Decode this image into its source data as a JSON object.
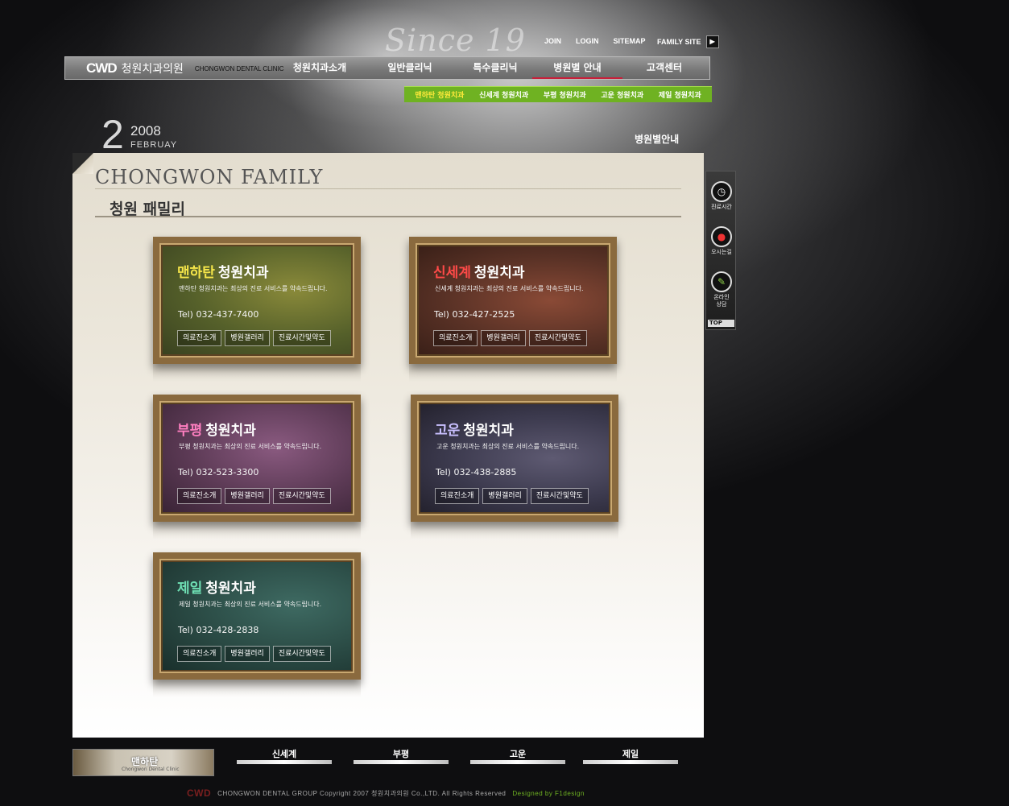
{
  "header": {
    "since_text": "Since 19",
    "top_links": [
      "JOIN",
      "LOGIN",
      "SITEMAP"
    ],
    "family_site": "FAMILY SITE"
  },
  "logo": {
    "mark": "CWD",
    "name_kr": "청원치과의원",
    "name_en": "CHONGWON DENTAL CLINIC"
  },
  "gnb": {
    "items": [
      "청원치과소개",
      "일반클리닉",
      "특수클리닉",
      "병원별 안내",
      "고객센터"
    ],
    "active": "병원별 안내"
  },
  "subnav": {
    "items": [
      "맨하탄 청원치과",
      "신세계 청원치과",
      "부평 청원치과",
      "고운 청원치과",
      "제일 청원치과"
    ],
    "active": "맨하탄 청원치과"
  },
  "date": {
    "day": "2",
    "year": "2008",
    "month": "FEBRUAY"
  },
  "breadcrumb": "병원별안내",
  "section": {
    "title_en": "CHONGWON  FAMILY",
    "title_kr": "청원 패밀리"
  },
  "clinics": [
    {
      "highlight": "맨하탄",
      "name": "청원치과",
      "desc": "맨하탄 청원치과는 최상의 진료 서비스를 약속드립니다.",
      "tel": "Tel) 032-437-7400",
      "buttons": [
        "의료진소개",
        "병원갤러리",
        "진료시간및약도"
      ],
      "highlight_color": "#f6e64a",
      "bg_color": "#5d6a2a"
    },
    {
      "highlight": "신세계",
      "name": "청원치과",
      "desc": "신세계 청원치과는 최상의 진료 서비스를 약속드립니다.",
      "tel": "Tel) 032-427-2525",
      "buttons": [
        "의료진소개",
        "병원갤러리",
        "진료시간및약도"
      ],
      "highlight_color": "#ff4a48",
      "bg_color": "#5a3226"
    },
    {
      "highlight": "부평",
      "name": "청원치과",
      "desc": "부평 청원치과는 최상의 진료 서비스를 약속드립니다.",
      "tel": "Tel) 032-523-3300",
      "buttons": [
        "의료진소개",
        "병원갤러리",
        "진료시간및약도"
      ],
      "highlight_color": "#ff7fc0",
      "bg_color": "#5c3a55"
    },
    {
      "highlight": "고운",
      "name": "청원치과",
      "desc": "고운 청원치과는 최상의 진료 서비스를 약속드립니다.",
      "tel": "Tel) 032-438-2885",
      "buttons": [
        "의료진소개",
        "병원갤러리",
        "진료시간및약도"
      ],
      "highlight_color": "#c9c0ff",
      "bg_color": "#3c3a4e"
    },
    {
      "highlight": "제일",
      "name": "청원치과",
      "desc": "제일 청원치과는 최상의 진료 서비스를 약속드립니다.",
      "tel": "Tel) 032-428-2838",
      "buttons": [
        "의료진소개",
        "병원갤러리",
        "진료시간및약도"
      ],
      "highlight_color": "#6fe0b4",
      "bg_color": "#2a4a44"
    }
  ],
  "quick_menu": {
    "items": [
      {
        "icon": "clock-icon",
        "label": "진료시간"
      },
      {
        "icon": "traffic-light-icon",
        "label": "오시는길"
      },
      {
        "icon": "chat-icon",
        "label": "온라인 상담"
      }
    ],
    "top": "TOP"
  },
  "bottom_banners": {
    "first": {
      "name": "맨하탄",
      "sub": "Chongwon Dental Clinic"
    },
    "others": [
      "신세계",
      "부평",
      "고운",
      "제일"
    ]
  },
  "footer": {
    "mark": "CWD",
    "text": "CHONGWON DENTAL GROUP Copyright 2007 청원치과의원 Co.,LTD. All Rights Reserved",
    "designed": "Designed by F1design"
  }
}
